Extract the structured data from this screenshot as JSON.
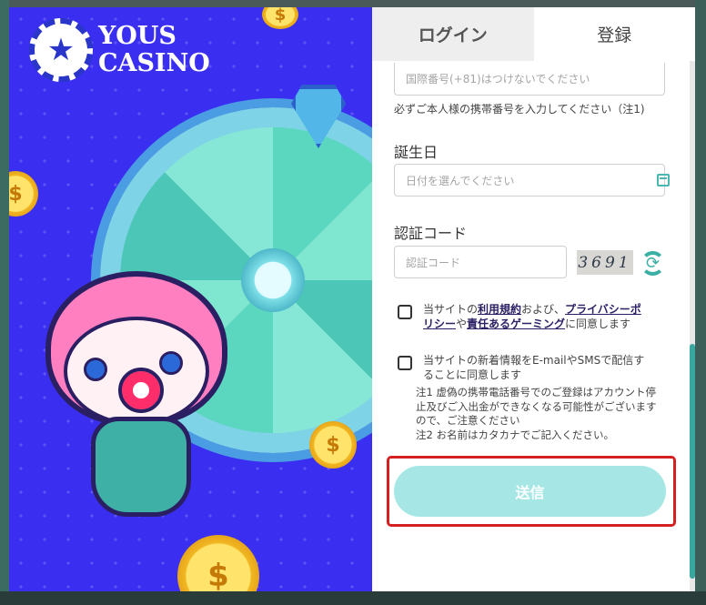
{
  "brand": {
    "logo_line1": "YOUS",
    "logo_line2": "CASINO",
    "logo_icon": "star-chip-icon"
  },
  "tabs": [
    {
      "label": "ログイン",
      "active": false
    },
    {
      "label": "登録",
      "active": true
    }
  ],
  "form": {
    "phone": {
      "placeholder": "国際番号(+81)はつけないでください",
      "hint": "必ずご本人様の携帯番号を入力してください（注1)"
    },
    "birthday": {
      "label": "誕生日",
      "placeholder": "日付を選んでください",
      "icon": "calendar-icon"
    },
    "verification": {
      "label": "認証コード",
      "placeholder": "認証コード",
      "captcha": "3691",
      "refresh_icon": "refresh-icon"
    },
    "terms": {
      "prefix": "当サイトの",
      "link_terms": "利用規約",
      "mid1": "および、",
      "link_privacy": "プライバシーポリシー",
      "mid2": "や",
      "link_responsible": "責任あるゲーミング",
      "suffix": "に同意します"
    },
    "newsletter": "当サイトの新着情報をE-mailやSMSで配信することに同意します",
    "notes": [
      "注1 虚偽の携帯電話番号でのご登録はアカウント停止及びご入出金ができなくなる可能性がございますので、ご注意ください",
      "注2 お名前はカタカナでご記入ください。"
    ],
    "submit_label": "送信"
  },
  "colors": {
    "accent": "#3aafa3",
    "submit_bg": "#a6e7e6",
    "highlight": "#d42020",
    "promo_bg": "#3a2ff0"
  }
}
